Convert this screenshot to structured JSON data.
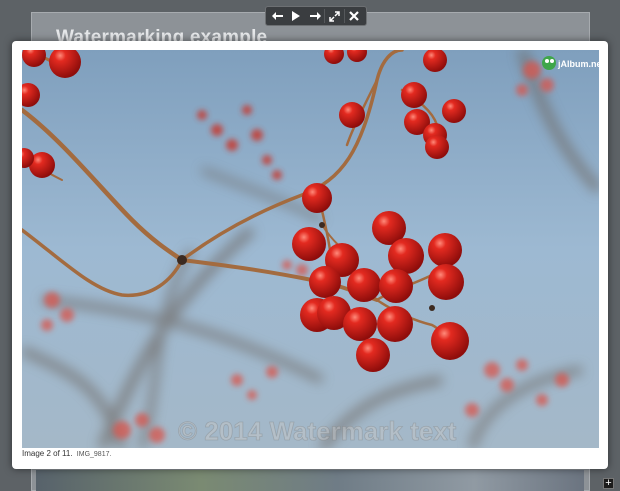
{
  "page": {
    "title": "Watermarking example"
  },
  "toolbar": {
    "buttons": [
      {
        "name": "prev-icon"
      },
      {
        "name": "play-icon"
      },
      {
        "name": "next-icon"
      },
      {
        "name": "fullscreen-icon"
      },
      {
        "name": "close-icon"
      }
    ]
  },
  "lightbox": {
    "caption_main": "Image 2 of 11.",
    "caption_file": "IMG_9817.",
    "watermark": "© 2014 Watermark text",
    "logo": "jAlbum.net"
  },
  "colors": {
    "sky": "#8fb0cc",
    "berry": "#d71e1a",
    "stem": "#a36b3f"
  },
  "corner_button": {
    "label": "+"
  }
}
